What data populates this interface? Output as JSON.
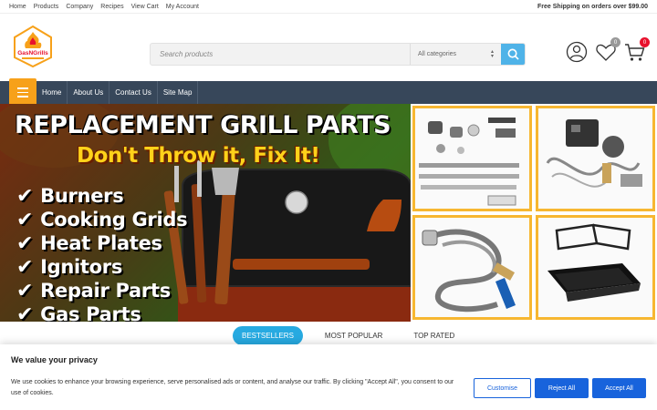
{
  "topbar": {
    "links": [
      "Home",
      "Products",
      "Company",
      "Recipes",
      "View Cart",
      "My Account"
    ],
    "shipping": "Free Shipping on orders over $99.00"
  },
  "logo": {
    "text": "GasNGrills"
  },
  "search": {
    "placeholder": "Search products",
    "category": "All categories"
  },
  "header_icons": {
    "wishlist_count": "0",
    "cart_count": "0"
  },
  "nav": {
    "items": [
      "Home",
      "About Us",
      "Contact Us",
      "Site Map"
    ]
  },
  "banner": {
    "title": "REPLACEMENT GRILL PARTS",
    "subtitle": "Don't Throw it, Fix It!",
    "list": [
      "Burners",
      "Cooking Grids",
      "Heat Plates",
      "Ignitors",
      "Repair Parts",
      "Gas Parts"
    ]
  },
  "tabs": [
    "BESTSELLERS",
    "MOST POPULAR",
    "TOP RATED"
  ],
  "cookie": {
    "title": "We value your privacy",
    "text": "We use cookies to enhance your browsing experience, serve personalised ads or content, and analyse our traffic. By clicking \"Accept All\", you consent to our use of cookies.",
    "customise": "Customise",
    "reject": "Reject All",
    "accept": "Accept All"
  },
  "colors": {
    "nav_bg": "#37475a",
    "accent_orange": "#f7a11a",
    "accent_blue": "#27aae1",
    "cookie_blue": "#1863dc",
    "badge_red": "#e8112d",
    "badge_grey": "#999999"
  }
}
